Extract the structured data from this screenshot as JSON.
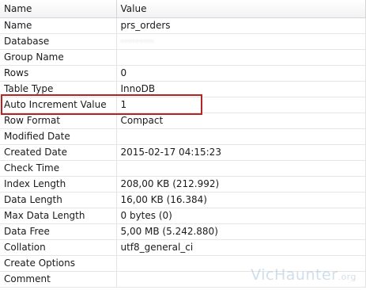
{
  "header": {
    "name": "Name",
    "value": "Value"
  },
  "rows": [
    {
      "name": "Name",
      "value": "prs_orders"
    },
    {
      "name": "Database",
      "value": ""
    },
    {
      "name": "Group Name",
      "value": ""
    },
    {
      "name": "Rows",
      "value": "0"
    },
    {
      "name": "Table Type",
      "value": "InnoDB"
    },
    {
      "name": "Auto Increment Value",
      "value": "1"
    },
    {
      "name": "Row Format",
      "value": "Compact"
    },
    {
      "name": "Modified Date",
      "value": ""
    },
    {
      "name": "Created Date",
      "value": "2015-02-17 04:15:23"
    },
    {
      "name": "Check Time",
      "value": ""
    },
    {
      "name": "Index Length",
      "value": "208,00 KB (212.992)"
    },
    {
      "name": "Data Length",
      "value": "16,00 KB (16.384)"
    },
    {
      "name": "Max Data Length",
      "value": "0 bytes (0)"
    },
    {
      "name": "Data Free",
      "value": "5,00 MB (5.242.880)"
    },
    {
      "name": "Collation",
      "value": "utf8_general_ci"
    },
    {
      "name": "Create Options",
      "value": ""
    },
    {
      "name": "Comment",
      "value": ""
    }
  ],
  "watermark": {
    "main": "VicHaunter",
    "suffix": ".org"
  },
  "colors": {
    "highlight": "#b52424",
    "header_bg": "#f1f2f4",
    "grid_line": "#e3e3e3"
  }
}
